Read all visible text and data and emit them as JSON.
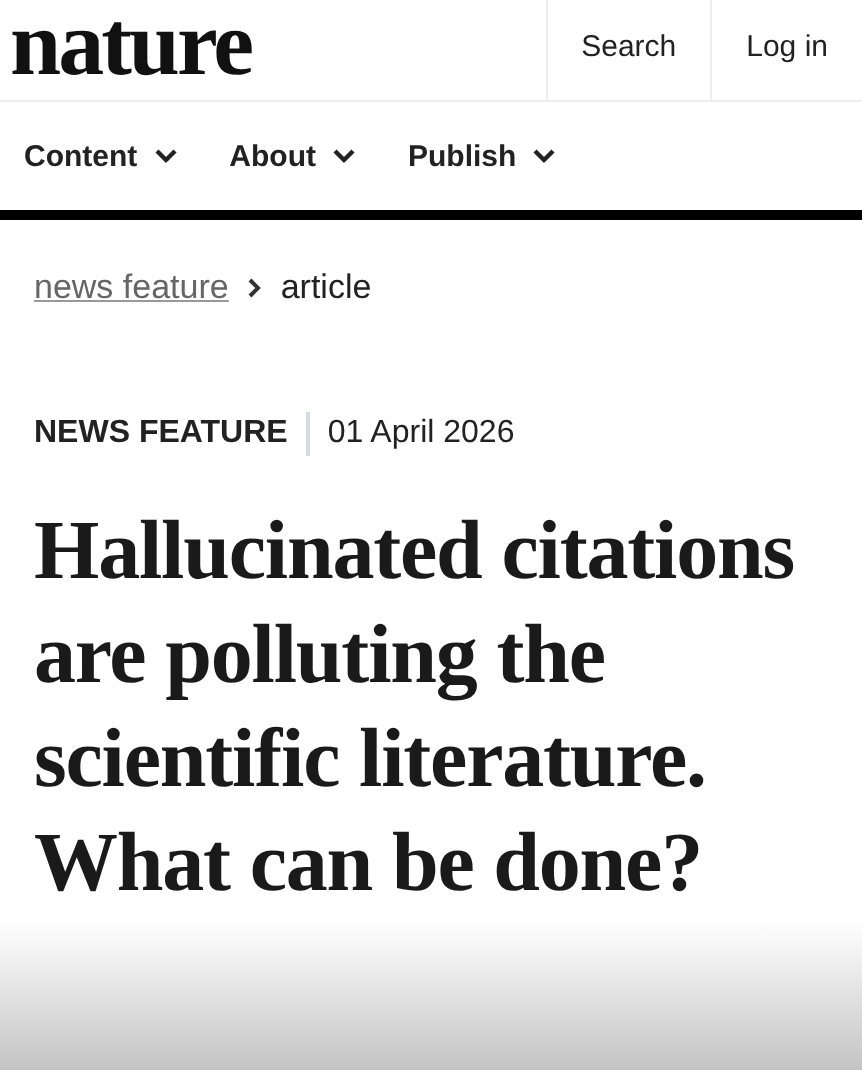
{
  "header": {
    "logo": "nature",
    "actions": [
      "Search",
      "Log in"
    ]
  },
  "nav": [
    {
      "label": "Content",
      "expanded": false
    },
    {
      "label": "About",
      "expanded": false
    },
    {
      "label": "Publish",
      "expanded": false
    }
  ],
  "breadcrumb": [
    {
      "label": "news feature",
      "kind": "link"
    },
    {
      "label": "article",
      "kind": "current"
    }
  ],
  "article": {
    "type": "NEWS FEATURE",
    "date": "01 April 2026",
    "title": "Hallucinated citations are polluting the scientific literature. What can be done?"
  }
}
